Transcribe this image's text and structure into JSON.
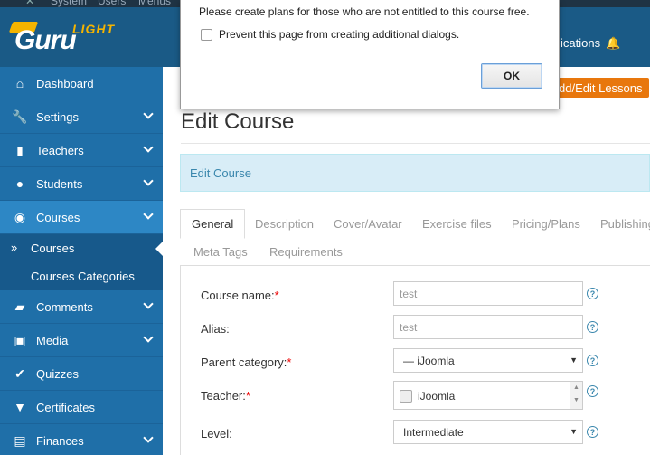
{
  "topbar": {
    "items": [
      "System",
      "Users",
      "Menus"
    ]
  },
  "header": {
    "logo_text": "Guru",
    "logo_badge": "LIGHT",
    "notifications_label": "ications"
  },
  "sidebar": {
    "items": [
      {
        "label": "Dashboard",
        "icon": "home-icon"
      },
      {
        "label": "Settings",
        "icon": "wrench-icon"
      },
      {
        "label": "Teachers",
        "icon": "book-icon"
      },
      {
        "label": "Students",
        "icon": "user-icon"
      },
      {
        "label": "Courses",
        "icon": "eye-icon"
      },
      {
        "label": "Comments",
        "icon": "comments-icon"
      },
      {
        "label": "Media",
        "icon": "image-icon"
      },
      {
        "label": "Quizzes",
        "icon": "check-circle-icon"
      },
      {
        "label": "Certificates",
        "icon": "bookmark-icon"
      },
      {
        "label": "Finances",
        "icon": "finances-icon"
      }
    ],
    "courses_sub": [
      {
        "label": "Courses"
      },
      {
        "label": "Courses Categories"
      }
    ]
  },
  "toolbar": {
    "add_edit_lessons": "dd/Edit Lessons"
  },
  "main": {
    "page_title": "Edit Course",
    "info_bar": "Edit Course",
    "tabs": [
      {
        "label": "General"
      },
      {
        "label": "Description"
      },
      {
        "label": "Cover/Avatar"
      },
      {
        "label": "Exercise files"
      },
      {
        "label": "Pricing/Plans"
      },
      {
        "label": "Publishing"
      },
      {
        "label": "Meta Tags"
      },
      {
        "label": "Requirements"
      }
    ],
    "form": {
      "course_name_label": "Course name:",
      "course_name_value": "test",
      "alias_label": "Alias:",
      "alias_value": "test",
      "parent_category_label": "Parent category:",
      "parent_category_value": "— iJoomla",
      "teacher_label": "Teacher:",
      "teacher_value": "iJoomla",
      "level_label": "Level:",
      "level_value": "Intermediate",
      "required_mark": "*",
      "help_glyph": "?"
    }
  },
  "dialog": {
    "message": "Please create plans for those who are not entitled to this course free.",
    "checkbox_label": "Prevent this page from creating additional dialogs.",
    "ok_label": "OK"
  },
  "colors": {
    "sidebar_bg": "#1f6fa8",
    "header_bg": "#1a5a86",
    "accent_orange": "#e8770d",
    "info_bg": "#d8edf7"
  }
}
